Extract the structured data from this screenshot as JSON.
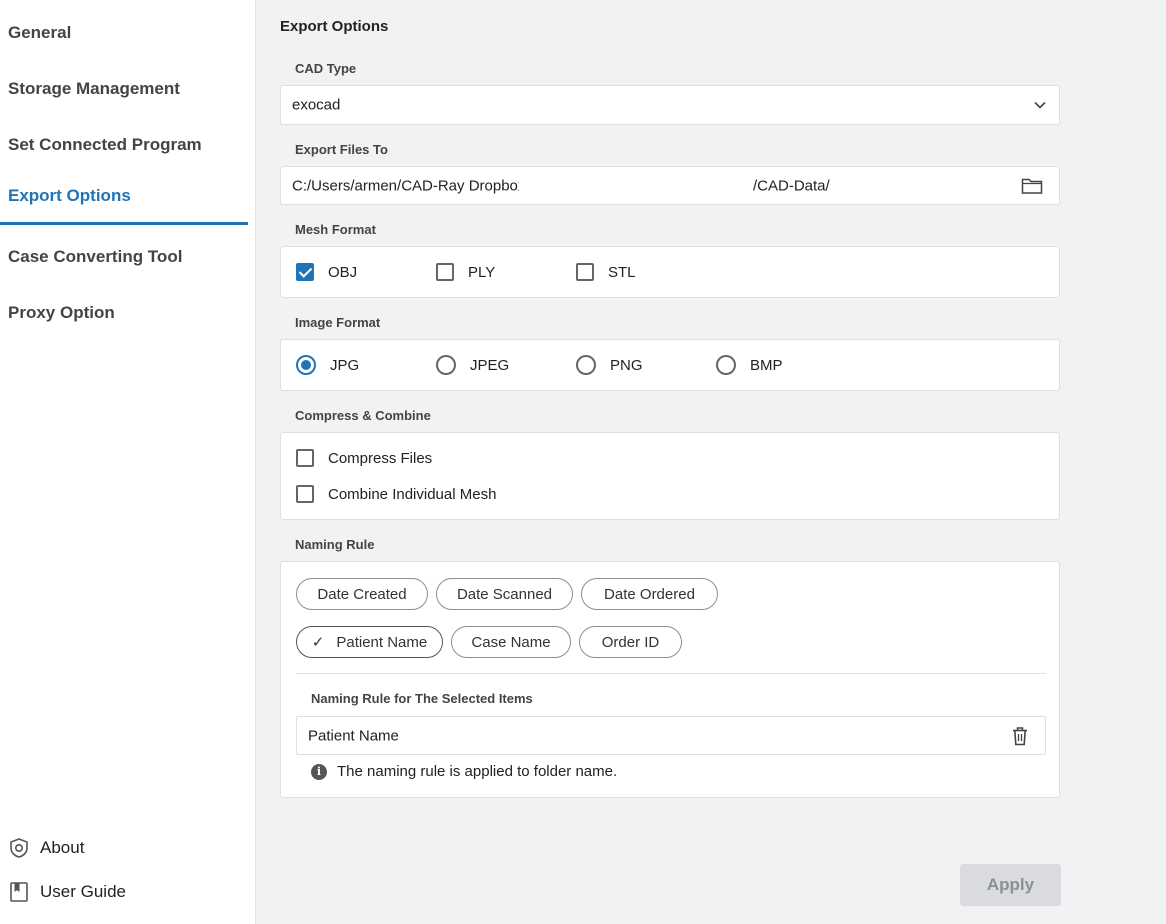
{
  "sidebar": {
    "items": [
      {
        "label": "General"
      },
      {
        "label": "Storage Management"
      },
      {
        "label": "Set Connected Program"
      },
      {
        "label": "Export Options",
        "active": true
      },
      {
        "label": "Case Converting Tool"
      },
      {
        "label": "Proxy Option"
      }
    ],
    "bottom": {
      "about": "About",
      "user_guide": "User Guide"
    }
  },
  "main": {
    "title": "Export Options",
    "cad_type": {
      "label": "CAD Type",
      "value": "exocad"
    },
    "export_files_to": {
      "label": "Export Files To",
      "path_prefix": "C:/Users/armen/CAD-Ray Dropbox",
      "path_suffix": "/CAD-Data/"
    },
    "mesh_format": {
      "label": "Mesh Format",
      "options": [
        {
          "label": "OBJ",
          "checked": true
        },
        {
          "label": "PLY",
          "checked": false
        },
        {
          "label": "STL",
          "checked": false
        }
      ]
    },
    "image_format": {
      "label": "Image Format",
      "options": [
        {
          "label": "JPG",
          "selected": true
        },
        {
          "label": "JPEG",
          "selected": false
        },
        {
          "label": "PNG",
          "selected": false
        },
        {
          "label": "BMP",
          "selected": false
        }
      ]
    },
    "compress_combine": {
      "label": "Compress & Combine",
      "options": [
        {
          "label": "Compress Files",
          "checked": false
        },
        {
          "label": "Combine Individual Mesh",
          "checked": false
        }
      ]
    },
    "naming_rule": {
      "label": "Naming Rule",
      "chips": [
        {
          "label": "Date Created",
          "selected": false
        },
        {
          "label": "Date Scanned",
          "selected": false
        },
        {
          "label": "Date Ordered",
          "selected": false
        },
        {
          "label": "Patient Name",
          "selected": true
        },
        {
          "label": "Case Name",
          "selected": false
        },
        {
          "label": "Order ID",
          "selected": false
        }
      ],
      "selected_label": "Naming Rule for The Selected Items",
      "selected_value": "Patient Name",
      "info": "The naming rule is applied to folder name."
    },
    "apply_label": "Apply"
  },
  "colors": {
    "accent": "#1f73b7",
    "background": "#f1f2f4",
    "disabled_button": "#d9dbdf"
  },
  "icons": [
    "chevron-down-icon",
    "folder-icon",
    "checkmark-icon",
    "trash-icon",
    "info-icon",
    "shield-icon",
    "book-icon"
  ]
}
